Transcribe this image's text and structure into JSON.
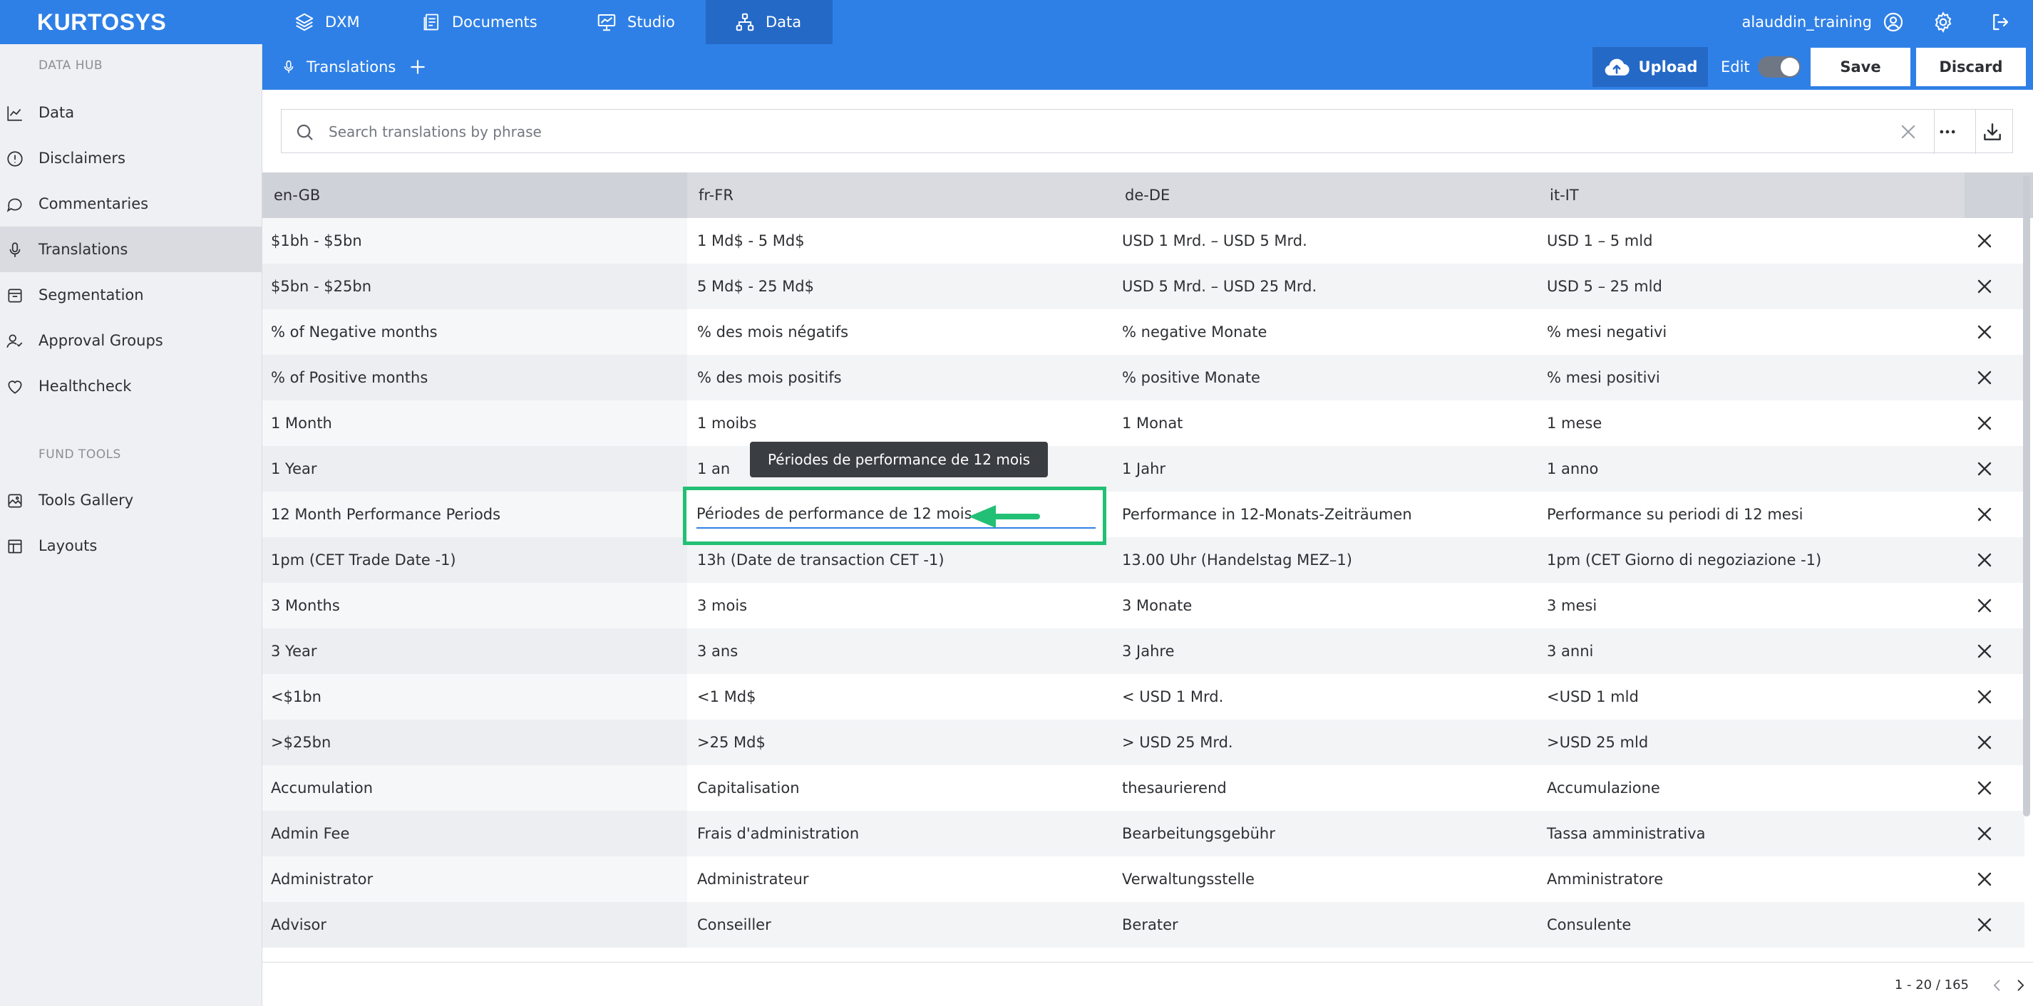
{
  "app": {
    "logo": "KURTOSYS"
  },
  "nav": {
    "tabs": [
      {
        "label": "DXM",
        "icon": "layers-icon"
      },
      {
        "label": "Documents",
        "icon": "document-icon"
      },
      {
        "label": "Studio",
        "icon": "presentation-chart-icon"
      },
      {
        "label": "Data",
        "icon": "hierarchy-icon",
        "active": true
      }
    ],
    "username": "alauddin_training"
  },
  "sidebar": {
    "section1": "DATA HUB",
    "items": [
      {
        "label": "Data",
        "icon": "line-chart-icon"
      },
      {
        "label": "Disclaimers",
        "icon": "alert-circle-icon"
      },
      {
        "label": "Commentaries",
        "icon": "chat-bubble-icon"
      },
      {
        "label": "Translations",
        "icon": "microphone-icon",
        "active": true
      },
      {
        "label": "Segmentation",
        "icon": "inbox-icon"
      },
      {
        "label": "Approval Groups",
        "icon": "user-check-icon"
      },
      {
        "label": "Healthcheck",
        "icon": "heart-icon"
      }
    ],
    "section2": "FUND TOOLS",
    "tools": [
      {
        "label": "Tools Gallery",
        "icon": "image-gallery-icon"
      },
      {
        "label": "Layouts",
        "icon": "layout-icon"
      }
    ]
  },
  "subheader": {
    "title": "Translations",
    "upload": "Upload",
    "edit": "Edit",
    "save": "Save",
    "discard": "Discard"
  },
  "search": {
    "placeholder": "Search translations by phrase",
    "value": ""
  },
  "table": {
    "columns": [
      "en-GB",
      "fr-FR",
      "de-DE",
      "it-IT"
    ],
    "rows": [
      [
        "$1bh - $5bn",
        "1 Md$ - 5 Md$",
        "USD 1 Mrd. – USD 5 Mrd.",
        "USD 1 – 5 mld"
      ],
      [
        "$5bn - $25bn",
        "5 Md$ - 25 Md$",
        "USD 5 Mrd. – USD 25 Mrd.",
        "USD 5 – 25 mld"
      ],
      [
        "% of Negative months",
        "% des mois négatifs",
        "% negative Monate",
        "% mesi negativi"
      ],
      [
        "% of Positive months",
        "% des mois positifs",
        "% positive Monate",
        "% mesi positivi"
      ],
      [
        "1 Month",
        "1 moibs",
        "1 Monat",
        "1 mese"
      ],
      [
        "1 Year",
        "1 an",
        "1 Jahr",
        "1 anno"
      ],
      [
        "12 Month Performance Periods",
        "Périodes de performance de 12 mois",
        "Performance in 12-Monats-Zeiträumen",
        "Performance su periodi di 12 mesi"
      ],
      [
        "1pm (CET Trade Date -1)",
        "13h (Date de transaction CET -1)",
        "13.00 Uhr (Handelstag MEZ–1)",
        "1pm (CET Giorno di negoziazione -1)"
      ],
      [
        "3 Months",
        "3 mois",
        "3 Monate",
        "3 mesi"
      ],
      [
        "3 Year",
        "3 ans",
        "3 Jahre",
        "3 anni"
      ],
      [
        "<$1bn",
        "<1 Md$",
        "< USD 1 Mrd.",
        "<USD 1 mld"
      ],
      [
        ">$25bn",
        ">25 Md$",
        "> USD 25 Mrd.",
        ">USD 25 mld"
      ],
      [
        "Accumulation",
        "Capitalisation",
        "thesaurierend",
        "Accumulazione"
      ],
      [
        "Admin Fee",
        "Frais d'administration",
        "Bearbeitungsgebühr",
        "Tassa amministrativa"
      ],
      [
        "Administrator",
        "Administrateur",
        "Verwaltungsstelle",
        "Amministratore"
      ],
      [
        "Advisor",
        "Conseiller",
        "Berater",
        "Consulente"
      ]
    ],
    "editing_value": "Périodes de performance de 12 mois",
    "tooltip": "Périodes de performance de 12 mois"
  },
  "pagination": {
    "range": "1 - 20 / 165"
  },
  "colors": {
    "primary": "#2f80e6",
    "primary_dark": "#2569c6",
    "highlight": "#22c074"
  }
}
